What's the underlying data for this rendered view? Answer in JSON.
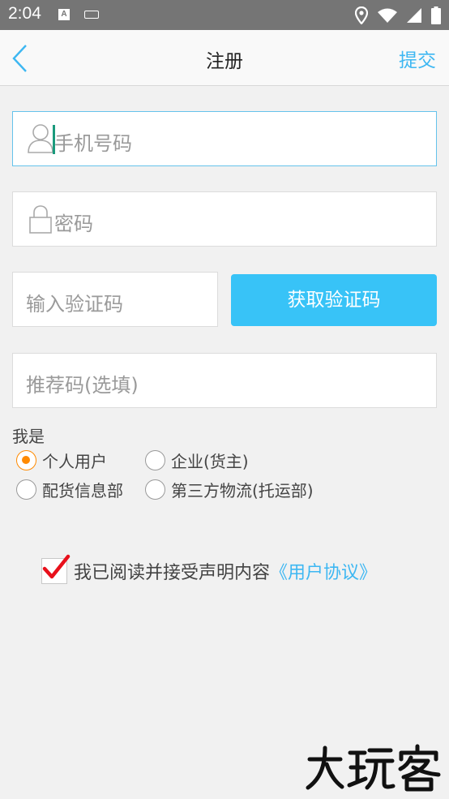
{
  "status_bar": {
    "time": "2:04",
    "notification_icon_letter": "A",
    "icons": [
      "a-notification-icon",
      "keyboard-icon",
      "location-icon",
      "wifi-icon",
      "signal-icon",
      "battery-icon"
    ]
  },
  "nav": {
    "back_icon": "chevron-left-icon",
    "title": "注册",
    "submit_label": "提交"
  },
  "form": {
    "phone_placeholder": "手机号码",
    "password_placeholder": "密码",
    "code_placeholder": "输入验证码",
    "get_code_label": "获取验证码",
    "referral_placeholder": "推荐码(选填)"
  },
  "role": {
    "label": "我是",
    "options": [
      {
        "label": "个人用户",
        "selected": true
      },
      {
        "label": "企业(货主)",
        "selected": false
      },
      {
        "label": "配货信息部",
        "selected": false
      },
      {
        "label": "第三方物流(托运部)",
        "selected": false
      }
    ]
  },
  "agreement": {
    "checked": true,
    "text": "我已阅读并接受声明内容",
    "link": "《用户协议》"
  },
  "watermark": {
    "text": "大玩客"
  },
  "colors": {
    "accent": "#3db7f2",
    "button": "#38c3f7",
    "radio_selected": "#ff8a00",
    "check": "#e8101b",
    "status_bar": "#757575",
    "background": "#f1f1f1"
  }
}
